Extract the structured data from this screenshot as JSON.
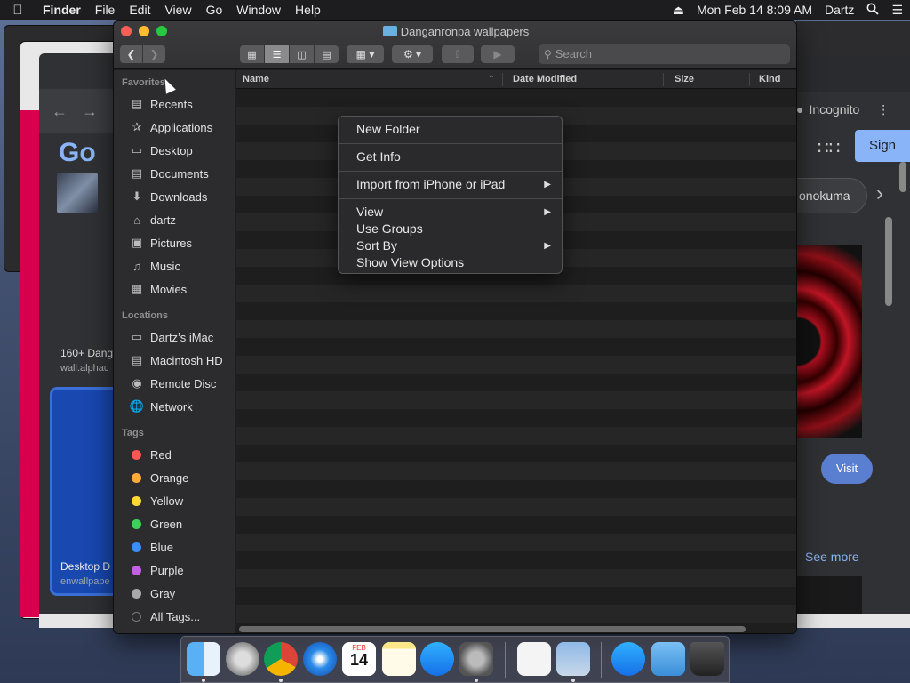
{
  "menubar": {
    "app_name": "Finder",
    "items": [
      "File",
      "Edit",
      "View",
      "Go",
      "Window",
      "Help"
    ],
    "datetime": "Mon Feb 14  8:09 AM",
    "user": "Dartz"
  },
  "background": {
    "chrome_left_160": "160+ Dang",
    "chrome_left_site": "wall.alphac",
    "chrome_left_card_title": "Desktop D",
    "chrome_left_card_site": "enwallpape",
    "incognito": "Incognito",
    "sign_in": "Sign",
    "monokuma": "onokuma",
    "visit": "Visit",
    "see_more": "See more"
  },
  "finder": {
    "title": "Danganronpa wallpapers",
    "search_placeholder": "Search",
    "columns": {
      "name": "Name",
      "date_modified": "Date Modified",
      "size": "Size",
      "kind": "Kind"
    },
    "sidebar": {
      "favorites_label": "Favorites",
      "favorites": [
        {
          "label": "Recents",
          "icon": "recents-icon"
        },
        {
          "label": "Applications",
          "icon": "applications-icon"
        },
        {
          "label": "Desktop",
          "icon": "desktop-icon"
        },
        {
          "label": "Documents",
          "icon": "documents-icon"
        },
        {
          "label": "Downloads",
          "icon": "downloads-icon"
        },
        {
          "label": "dartz",
          "icon": "home-icon"
        },
        {
          "label": "Pictures",
          "icon": "pictures-icon"
        },
        {
          "label": "Music",
          "icon": "music-icon"
        },
        {
          "label": "Movies",
          "icon": "movies-icon"
        }
      ],
      "locations_label": "Locations",
      "locations": [
        {
          "label": "Dartz’s iMac",
          "icon": "imac-icon"
        },
        {
          "label": "Macintosh HD",
          "icon": "disk-icon"
        },
        {
          "label": "Remote Disc",
          "icon": "disc-icon"
        },
        {
          "label": "Network",
          "icon": "network-icon"
        }
      ],
      "tags_label": "Tags",
      "tags": [
        {
          "label": "Red",
          "color": "#fc5753"
        },
        {
          "label": "Orange",
          "color": "#fdaa3a"
        },
        {
          "label": "Yellow",
          "color": "#fed933"
        },
        {
          "label": "Green",
          "color": "#3ed05d"
        },
        {
          "label": "Blue",
          "color": "#3b8df7"
        },
        {
          "label": "Purple",
          "color": "#c061e0"
        },
        {
          "label": "Gray",
          "color": "#a8a8aa"
        },
        {
          "label": "All Tags...",
          "color": "#555555"
        }
      ]
    }
  },
  "context_menu": {
    "new_folder": "New Folder",
    "get_info": "Get Info",
    "import": "Import from iPhone or iPad",
    "view": "View",
    "use_groups": "Use Groups",
    "sort_by": "Sort By",
    "show_view_options": "Show View Options"
  },
  "dock": {
    "calendar_month": "FEB",
    "calendar_day": "14"
  }
}
